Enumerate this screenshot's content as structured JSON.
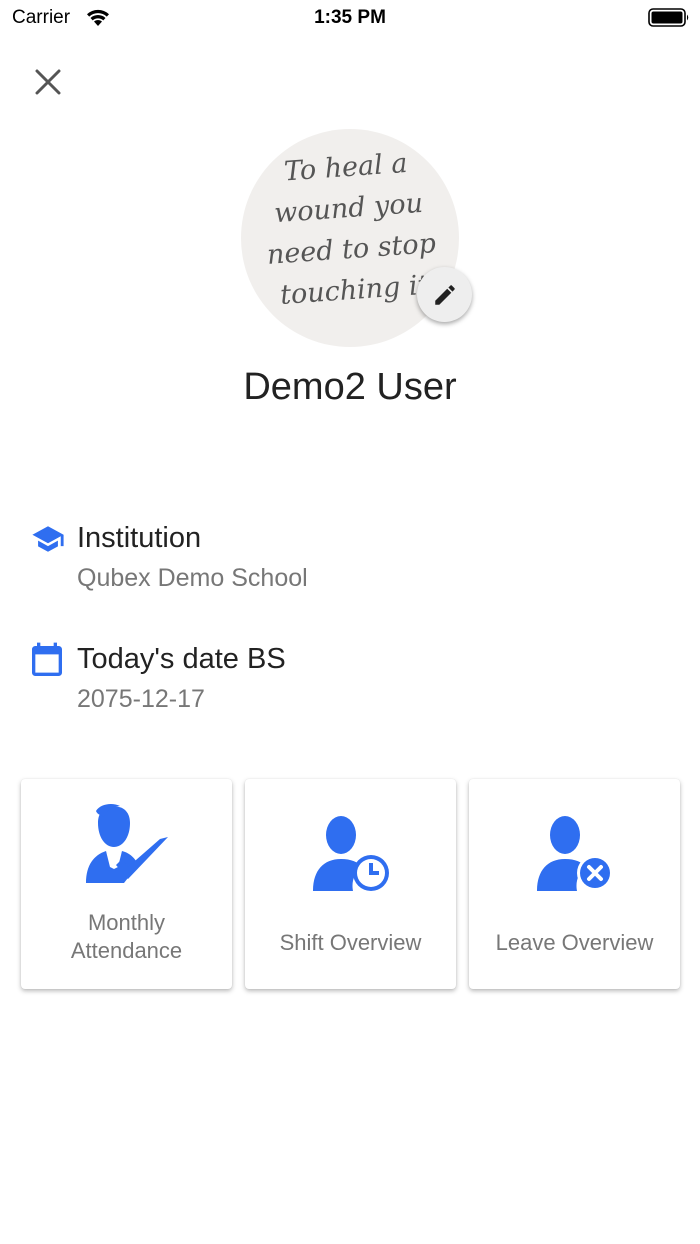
{
  "status_bar": {
    "carrier": "Carrier",
    "time": "1:35 PM"
  },
  "profile": {
    "avatar_quote": [
      "To heal a",
      "wound you",
      "need to stop",
      "touching it"
    ],
    "name": "Demo2 User"
  },
  "info": {
    "institution": {
      "label": "Institution",
      "value": "Qubex Demo School",
      "icon": "graduation-cap-icon"
    },
    "date": {
      "label": "Today's date BS",
      "value": "2075-12-17",
      "icon": "calendar-icon"
    }
  },
  "cards": [
    {
      "label_line1": "Monthly",
      "label_line2": "Attendance",
      "icon": "user-check-icon"
    },
    {
      "label": "Shift Overview",
      "icon": "user-clock-icon"
    },
    {
      "label": "Leave Overview",
      "icon": "user-remove-icon"
    }
  ],
  "colors": {
    "accent": "#2f6ef0",
    "text_primary": "#222222",
    "text_secondary": "#777777"
  }
}
